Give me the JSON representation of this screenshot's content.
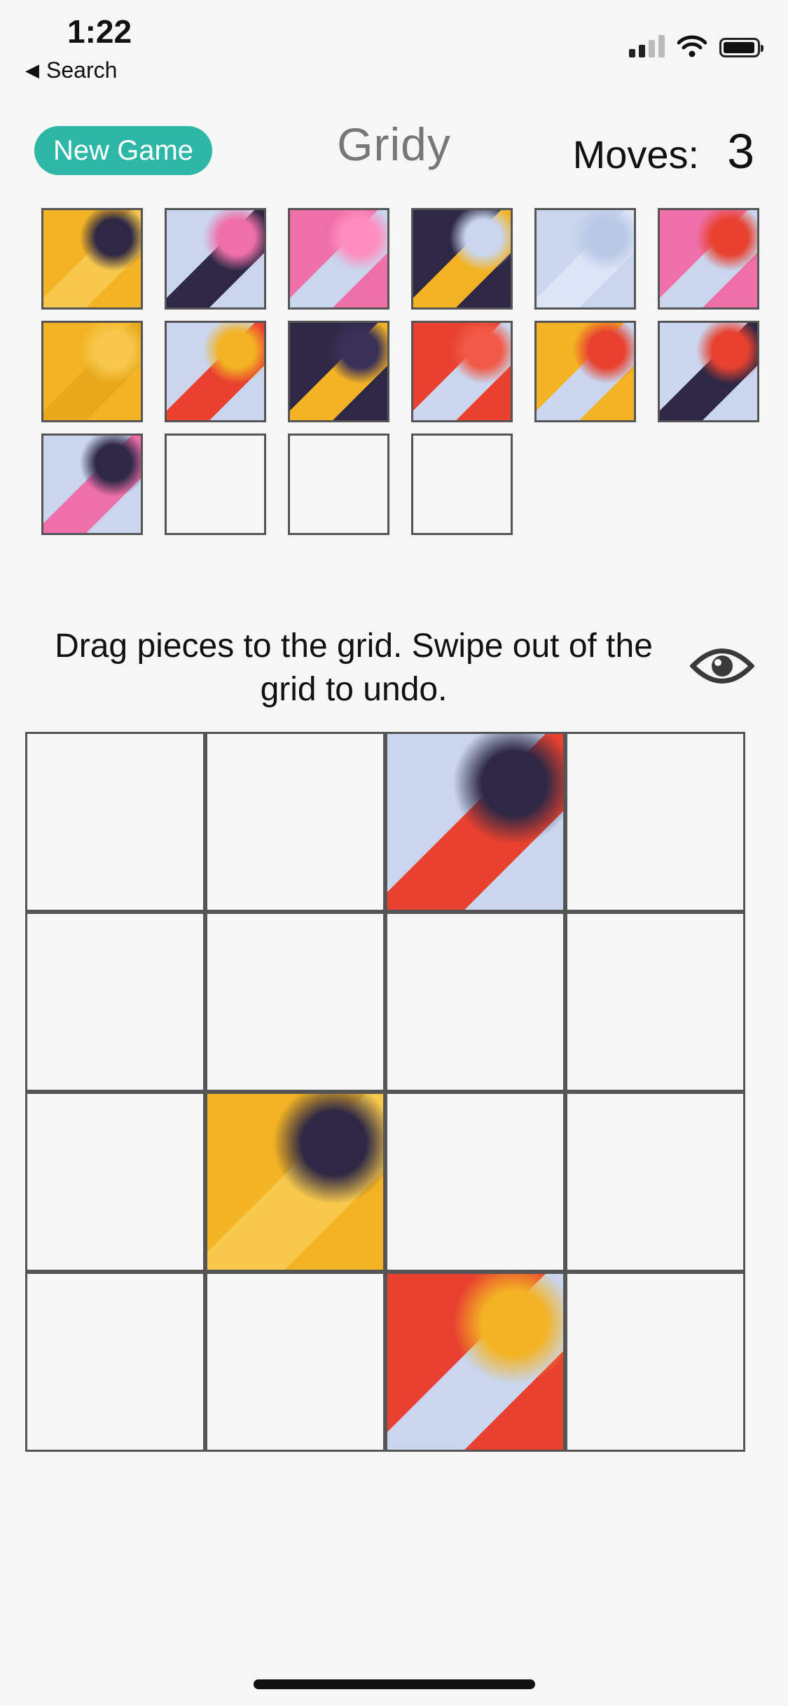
{
  "status_bar": {
    "time": "1:22",
    "back_label": "Search"
  },
  "header": {
    "new_game_label": "New Game",
    "app_title": "Gridy",
    "moves_label": "Moves:",
    "moves_count": "3"
  },
  "instruction": "Drag pieces to the grid. Swipe out of the grid to undo.",
  "icons": {
    "back": "back-triangle-icon",
    "signal": "cellular-signal-icon",
    "wifi": "wifi-icon",
    "battery": "battery-icon",
    "eye": "eye-icon"
  },
  "colors": {
    "accent": "#2cb7a6",
    "yellow": "#f3b324",
    "pink": "#ef6fa8",
    "lightblue": "#c9d6ee",
    "navy": "#2e2845",
    "red": "#e8412f",
    "white": "#f2f4f8"
  },
  "tray": {
    "pieces": [
      {
        "colors": [
          "#f3b324",
          "#f7c84b",
          "#2e2845"
        ]
      },
      {
        "colors": [
          "#c9d6ee",
          "#2e2845",
          "#ef6fa8"
        ]
      },
      {
        "colors": [
          "#ef6fa8",
          "#c9d6ee",
          "#ff8ec0"
        ]
      },
      {
        "colors": [
          "#2e2845",
          "#f3b324",
          "#c9d6ee"
        ]
      },
      {
        "colors": [
          "#c9d6ee",
          "#dce5f6",
          "#b9c8e6"
        ]
      },
      {
        "colors": [
          "#ef6fa8",
          "#c9d6ee",
          "#e8412f"
        ]
      },
      {
        "colors": [
          "#f3b324",
          "#e8a81c",
          "#f7c84b"
        ]
      },
      {
        "colors": [
          "#c9d6ee",
          "#e8412f",
          "#f3b324"
        ]
      },
      {
        "colors": [
          "#2e2845",
          "#f3b324",
          "#3a3158"
        ]
      },
      {
        "colors": [
          "#e8412f",
          "#c9d6ee",
          "#f25a47"
        ]
      },
      {
        "colors": [
          "#f3b324",
          "#c9d6ee",
          "#e8412f"
        ]
      },
      {
        "colors": [
          "#c9d6ee",
          "#2e2845",
          "#e8412f"
        ]
      },
      {
        "colors": [
          "#c9d6ee",
          "#ef6fa8",
          "#2e2845"
        ]
      },
      {
        "empty": true
      },
      {
        "empty": true
      },
      {
        "empty": true
      }
    ]
  },
  "board": {
    "cells": [
      {
        "empty": true
      },
      {
        "empty": true
      },
      {
        "colors": [
          "#c9d6ee",
          "#e8412f",
          "#2e2845"
        ]
      },
      {
        "empty": true
      },
      {
        "empty": true
      },
      {
        "empty": true
      },
      {
        "empty": true
      },
      {
        "empty": true
      },
      {
        "empty": true
      },
      {
        "colors": [
          "#f3b324",
          "#f7c84b",
          "#2e2845"
        ]
      },
      {
        "empty": true
      },
      {
        "empty": true
      },
      {
        "empty": true
      },
      {
        "empty": true
      },
      {
        "colors": [
          "#e8412f",
          "#c9d6ee",
          "#f3b324"
        ]
      },
      {
        "empty": true
      }
    ]
  }
}
